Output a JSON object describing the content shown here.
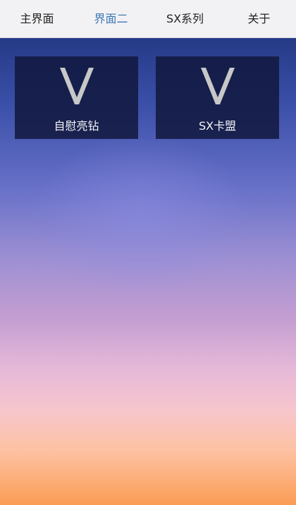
{
  "tabs": [
    {
      "label": "主界面",
      "active": false
    },
    {
      "label": "界面二",
      "active": true
    },
    {
      "label": "SX系列",
      "active": false
    },
    {
      "label": "关于",
      "active": false
    }
  ],
  "tiles": [
    {
      "label": "自慰亮钻",
      "icon": "v-logo-icon"
    },
    {
      "label": "SX卡盟",
      "icon": "v-logo-icon"
    }
  ],
  "colors": {
    "tab_bar_bg": "#f2f2f4",
    "tab_text": "#222222",
    "tab_active_text": "#3f78b6",
    "tile_bg": "#12183e",
    "tile_text": "#f4f4f8",
    "icon_color": "#c8c8c8"
  }
}
